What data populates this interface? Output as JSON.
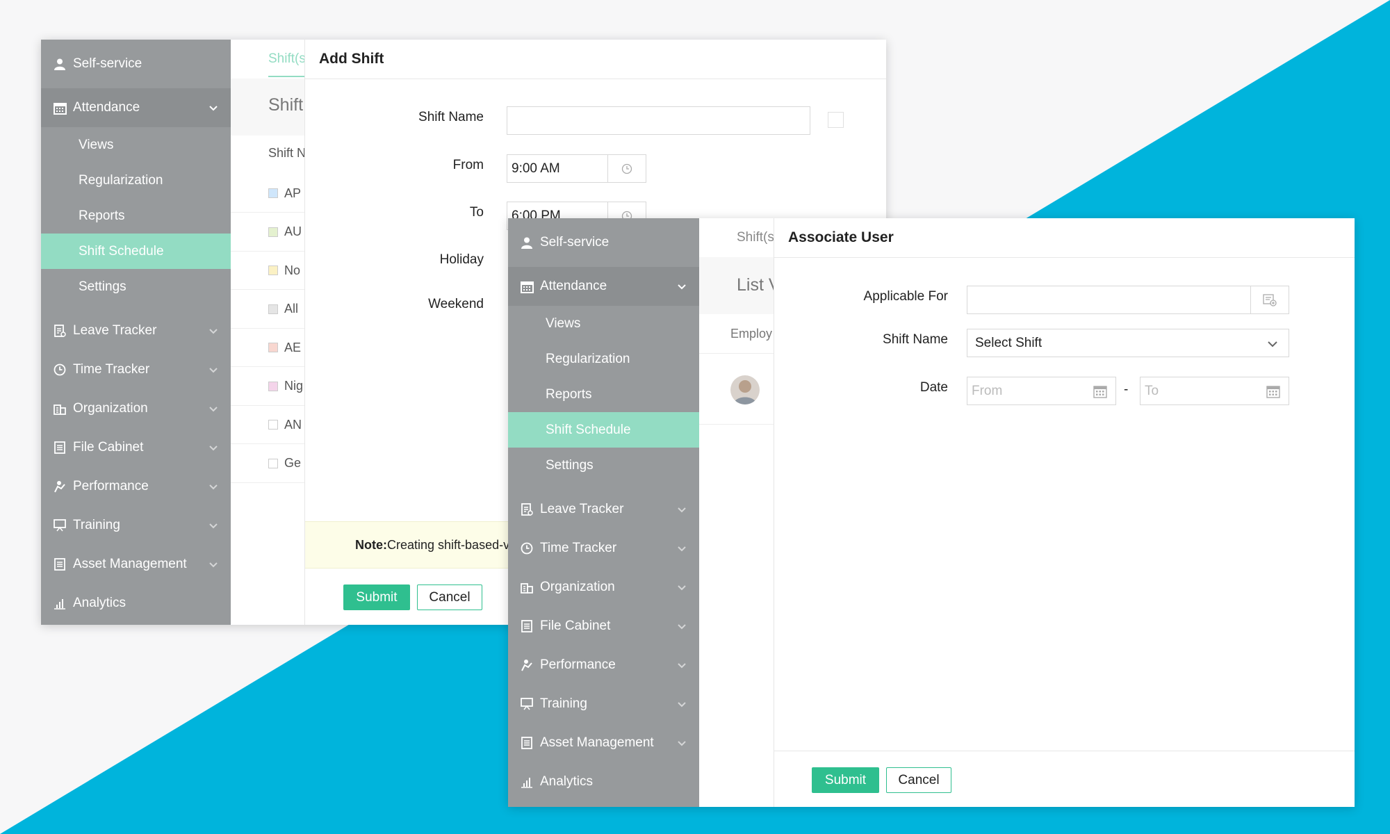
{
  "colors": {
    "accent": "#00b4dc",
    "sidebar": "#979a9c",
    "active": "#93dcc3",
    "primary_button": "#2fbf8f",
    "note_bg": "#fdfde8"
  },
  "sidebar": {
    "self_service": "Self-service",
    "attendance": "Attendance",
    "sub": [
      "Views",
      "Regularization",
      "Reports",
      "Shift Schedule",
      "Settings"
    ],
    "modules": [
      "Leave Tracker",
      "Time Tracker",
      "Organization",
      "File Cabinet",
      "Performance",
      "Training",
      "Asset Management",
      "Analytics"
    ]
  },
  "window1": {
    "tab_partial": "Shift(s",
    "heading_partial": "Shift",
    "col_partial": "Shift N",
    "rows": [
      "AP",
      "AU",
      "No",
      "All",
      "AE",
      "Nig",
      "AN",
      "Ge"
    ],
    "row_colors": [
      "#cfe6fb",
      "#e4f1cf",
      "#fbf1c4",
      "#e5e5e5",
      "#f8d7d0",
      "#f4d4ea",
      "#ffffff",
      "#ffffff"
    ]
  },
  "add_shift": {
    "title": "Add Shift",
    "shift_name_label": "Shift Name",
    "from_label": "From",
    "from_value": "9:00 AM",
    "to_label": "To",
    "to_value": "6:00 PM",
    "holiday_label": "Holiday",
    "weekend_label": "Weekend",
    "note_bold": "Note:",
    "note_text": " Creating shift-based-v",
    "submit": "Submit",
    "cancel": "Cancel"
  },
  "window2": {
    "tab_partial": "Shift(s",
    "heading_partial": "List V",
    "col_partial": "Employ"
  },
  "associate_user": {
    "title": "Associate User",
    "applicable_for_label": "Applicable For",
    "shift_name_label": "Shift Name",
    "shift_select_value": "Select Shift",
    "date_label": "Date",
    "from_placeholder": "From",
    "to_placeholder": "To",
    "separator": "-",
    "submit": "Submit",
    "cancel": "Cancel"
  }
}
